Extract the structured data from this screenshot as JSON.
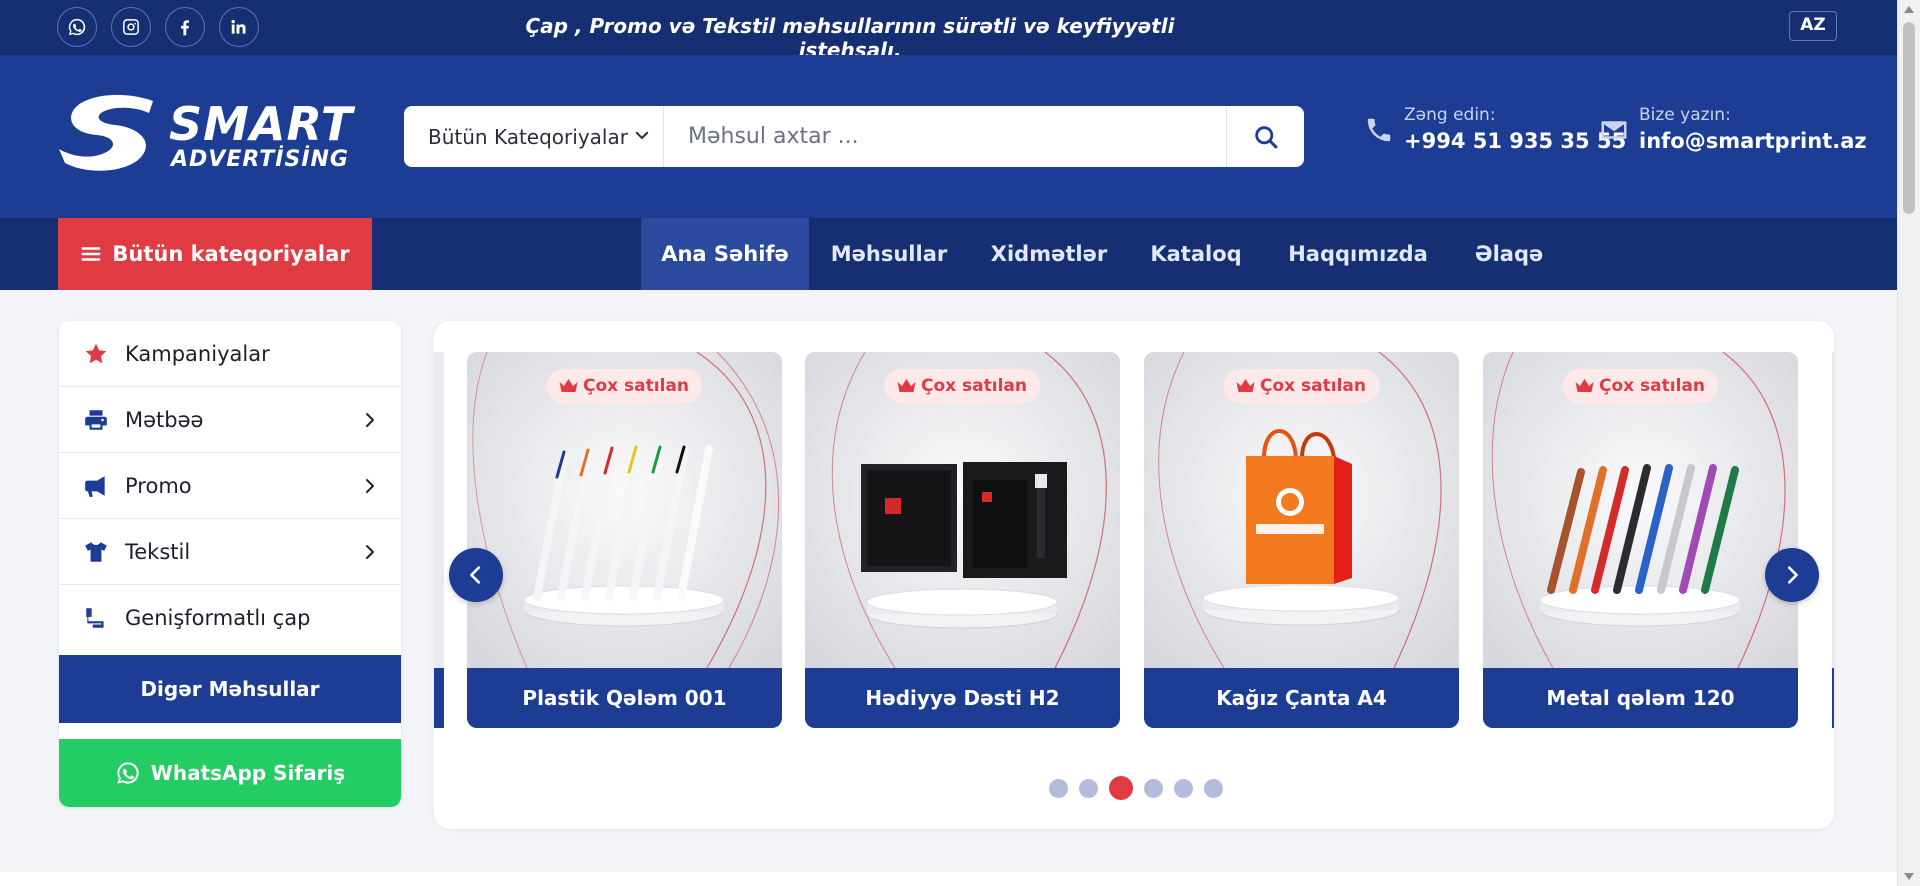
{
  "topbar": {
    "social": [
      {
        "icon": "whatsapp-icon"
      },
      {
        "icon": "instagram-icon"
      },
      {
        "icon": "facebook-icon"
      },
      {
        "icon": "linkedin-icon"
      }
    ],
    "tagline": "Çap , Promo və Tekstil məhsullarının sürətli və keyfiyyətli istehsalı.",
    "language": "AZ"
  },
  "header": {
    "logo_word": "SMART",
    "logo_sub": "ADVERTİSİNG",
    "search": {
      "category": "Bütün Kateqoriyalar",
      "placeholder": "Məhsul axtar ..."
    },
    "phone": {
      "label": "Zəng edin:",
      "value": "+994 51 935 35 55"
    },
    "email": {
      "label": "Bize yazın:",
      "value": "info@smartprint.az"
    }
  },
  "nav": {
    "all_categories": "Bütün kateqoriyalar",
    "links": [
      "Ana Səhifə",
      "Məhsullar",
      "Xidmətlər",
      "Kataloq",
      "Haqqımızda",
      "Əlaqə"
    ],
    "active_index": 0
  },
  "sidebar": {
    "items": [
      {
        "label": "Kampaniyalar",
        "icon": "star-icon",
        "has_submenu": false
      },
      {
        "label": "Mətbəə",
        "icon": "printer-icon",
        "has_submenu": true
      },
      {
        "label": "Promo",
        "icon": "megaphone-icon",
        "has_submenu": true
      },
      {
        "label": "Tekstil",
        "icon": "tshirt-icon",
        "has_submenu": true
      },
      {
        "label": "Genişformatlı çap",
        "icon": "paint-roller-icon",
        "has_submenu": false
      }
    ],
    "other_products": "Digər Məhsullar",
    "whatsapp_order": "WhatsApp Sifariş"
  },
  "slider": {
    "badge": "Çox satılan",
    "products": [
      {
        "name": "Plastik Qələm 001"
      },
      {
        "name": "Hədiyyə Dəsti H2"
      },
      {
        "name": "Kağız Çanta A4"
      },
      {
        "name": "Metal qələm 120"
      }
    ],
    "dot_count": 6,
    "active_dot": 2
  },
  "colors": {
    "topbar": "#162f72",
    "header": "#1d3d95",
    "accent_red": "#e03a43",
    "whatsapp_green": "#23cd63"
  }
}
